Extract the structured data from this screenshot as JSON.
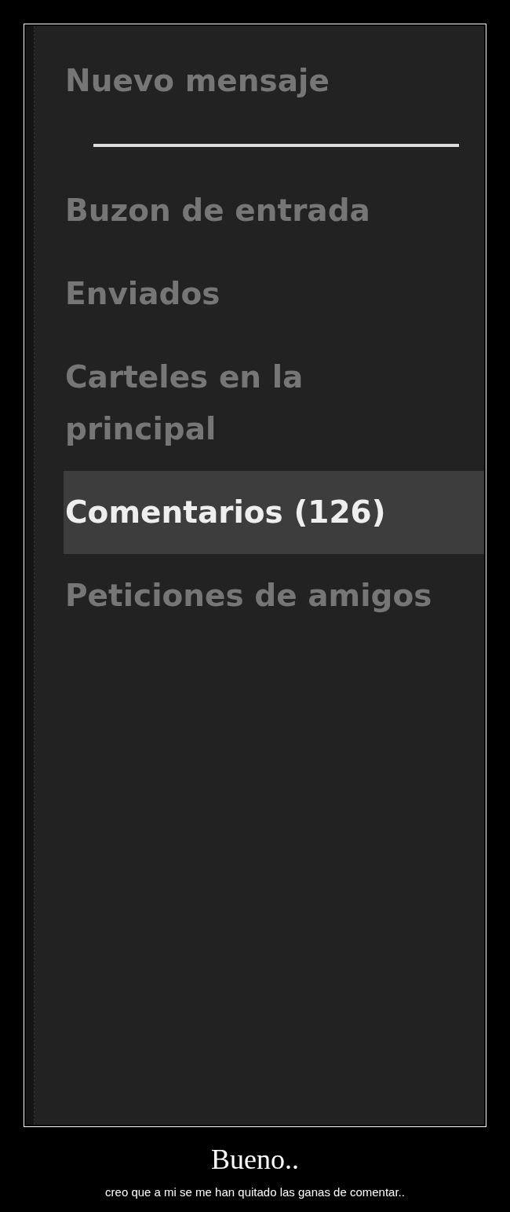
{
  "menu": {
    "items": [
      {
        "label": "Nuevo mensaje",
        "selected": false,
        "kind": "action"
      },
      {
        "label": "Buzon de entrada",
        "selected": false,
        "kind": "folder"
      },
      {
        "label": "Enviados",
        "selected": false,
        "kind": "folder"
      },
      {
        "label": "Carteles en la principal",
        "selected": false,
        "kind": "folder"
      },
      {
        "label": "Comentarios (126)",
        "selected": true,
        "kind": "folder"
      },
      {
        "label": "Peticiones de amigos",
        "selected": false,
        "kind": "folder"
      }
    ]
  },
  "title": "Bueno..",
  "caption": "creo que a mi se me han quitado las ganas de comentar.."
}
